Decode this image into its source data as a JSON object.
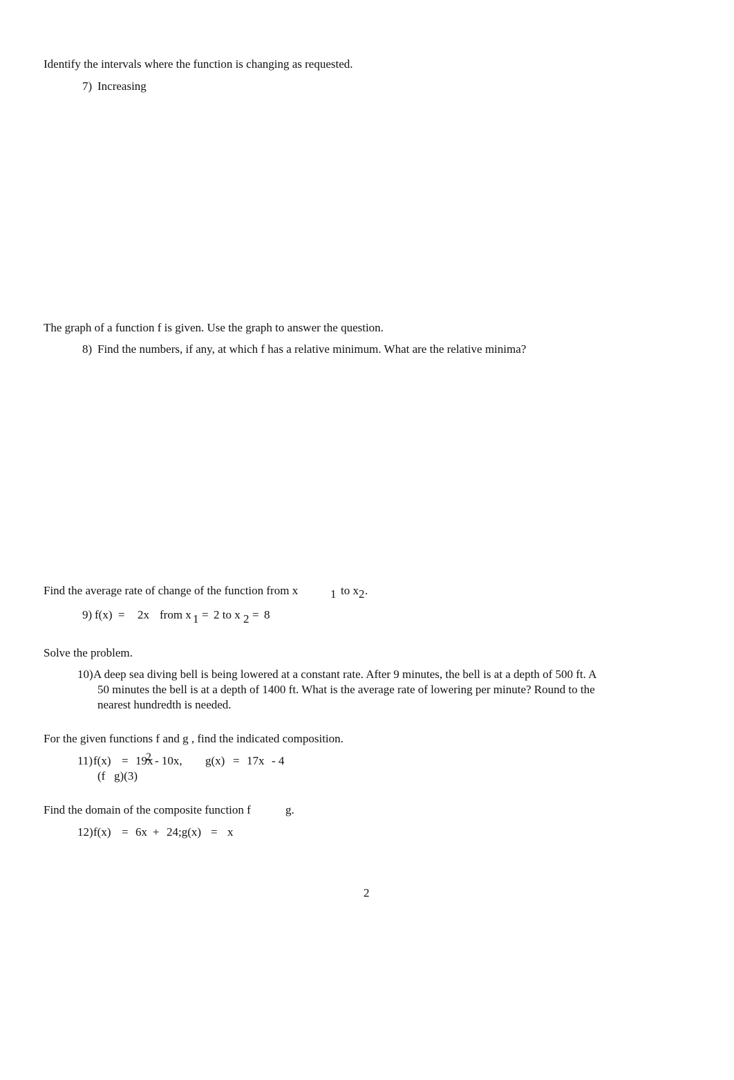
{
  "document": {
    "page_number": "2",
    "sections": [
      {
        "instruction": "Identify the intervals where the function is changing as requested.",
        "problem_number": "7)",
        "problem_text": "Increasing"
      },
      {
        "instruction": "The graph of a function f is given. Use the graph to answer the question.",
        "problem_number": "8)",
        "problem_text": "Find the numbers, if any, at which f has a relative minimum. What are the relative minima?"
      },
      {
        "instruction_prefix": "Find the average rate of change of the function from x",
        "instruction_sub1": "1",
        "instruction_mid": "to x",
        "instruction_sub2": "2",
        "instruction_end": ".",
        "problem_number": "9)",
        "fx": "f(x)",
        "eq": "=",
        "expr": "2x",
        "from": "from x",
        "sub1": "1",
        "eq1": "=",
        "x1_val": "2 to x",
        "sub2": "2",
        "eq2": "=",
        "x2_val": "8"
      },
      {
        "instruction": "Solve the problem.",
        "problem_number": "10)",
        "lines": [
          "A deep sea diving bell is being lowered at a constant rate. After 9 minutes, the bell is at a depth of 500 ft. A",
          "50 minutes the bell is at a depth of 1400 ft. What is the average rate of lowering per minute? Round to the",
          "nearest hundredth is needed."
        ]
      },
      {
        "instruction": "For the given functions f and g , find the indicated composition.",
        "problem_number": "11)",
        "fx": "f(x)",
        "eq": "=",
        "f_coef": "19x",
        "f_exp": "2",
        "f_rest": "- 10x,",
        "gx": "g(x)",
        "eq2": "=",
        "g_expr": "17x",
        "g_rest": "- 4",
        "composition_f": "(f",
        "composition_g": "g)(3)"
      },
      {
        "instruction_prefix": "Find the domain of the composite function f",
        "instruction_suffix": "g.",
        "problem_number": "12)",
        "fx": "f(x)",
        "eq": "=",
        "f_expr": "6x",
        "plus": "+",
        "f_rest": "24;g(x)",
        "eq2": "=",
        "g_expr": "x"
      }
    ]
  }
}
